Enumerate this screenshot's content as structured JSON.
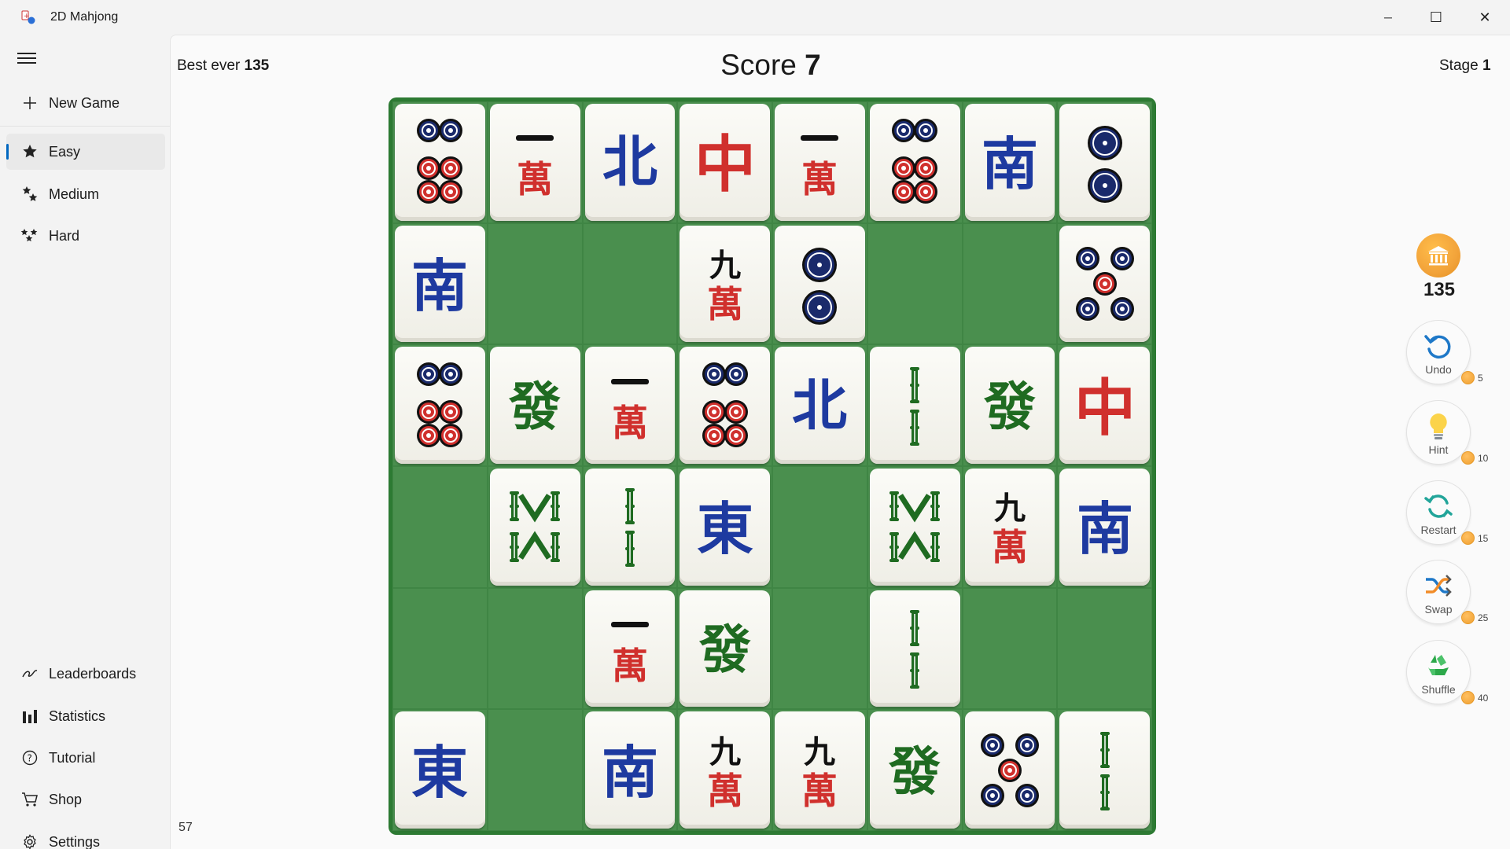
{
  "window": {
    "title": "2D Mahjong",
    "minimize_glyph": "─",
    "maximize_glyph": "☐",
    "close_glyph": "✕"
  },
  "sidebar": {
    "new_game": "New Game",
    "difficulties": [
      {
        "label": "Easy",
        "icon": "star-icon",
        "active": true
      },
      {
        "label": "Medium",
        "icon": "stars-icon",
        "active": false
      },
      {
        "label": "Hard",
        "icon": "three-stars-icon",
        "active": false
      }
    ],
    "bottom_items": [
      {
        "label": "Leaderboards",
        "icon": "leaderboard-icon"
      },
      {
        "label": "Statistics",
        "icon": "bar-chart-icon"
      },
      {
        "label": "Tutorial",
        "icon": "help-icon"
      },
      {
        "label": "Shop",
        "icon": "cart-icon"
      },
      {
        "label": "Settings",
        "icon": "gear-icon"
      }
    ],
    "footer_number": "57"
  },
  "header": {
    "best_label": "Best ever",
    "best_value": "135",
    "score_label": "Score",
    "score_value": "7",
    "stage_label": "Stage",
    "stage_value": "1"
  },
  "board": {
    "tile_names": {
      "C6": "six-circles",
      "C2": "two-circles",
      "C5": "five-circles",
      "M1": "one-character",
      "M9": "nine-character",
      "WN": "north-wind",
      "WS": "south-wind",
      "WE": "east-wind",
      "DR": "red-dragon",
      "DG": "green-dragon",
      "B2": "two-bamboo",
      "B8": "eight-bamboo"
    },
    "rows": [
      [
        "C6",
        "M1",
        "WN",
        "DR",
        "M1",
        "C6",
        "WS",
        "C2"
      ],
      [
        "WS",
        null,
        null,
        "M9",
        "C2",
        null,
        null,
        "C5"
      ],
      [
        "C6",
        "DG",
        "M1",
        "C6",
        "WN",
        "B2",
        "DG",
        "DR"
      ],
      [
        null,
        "B8",
        "B2",
        "WE",
        null,
        "B8",
        "M9",
        "WS"
      ],
      [
        null,
        null,
        "M1",
        "DG",
        null,
        "B2",
        null,
        null
      ],
      [
        "WE",
        null,
        "WS",
        "M9",
        "M9",
        "DG",
        "C5",
        "B2"
      ]
    ],
    "colors": {
      "board_frame": "#2d7a33",
      "empty_cell": "#4a8f4e",
      "tile_face": "#f7f6f1",
      "char_red": "#d0302d",
      "wind_blue": "#1e3aa0",
      "bamboo_green": "#1f6b21"
    }
  },
  "powerups": {
    "coins": "135",
    "buttons": [
      {
        "label": "Undo",
        "cost": "5",
        "icon": "undo-icon"
      },
      {
        "label": "Hint",
        "cost": "10",
        "icon": "lightbulb-icon"
      },
      {
        "label": "Restart",
        "cost": "15",
        "icon": "restart-icon"
      },
      {
        "label": "Swap",
        "cost": "25",
        "icon": "swap-icon"
      },
      {
        "label": "Shuffle",
        "cost": "40",
        "icon": "recycle-icon"
      }
    ]
  }
}
